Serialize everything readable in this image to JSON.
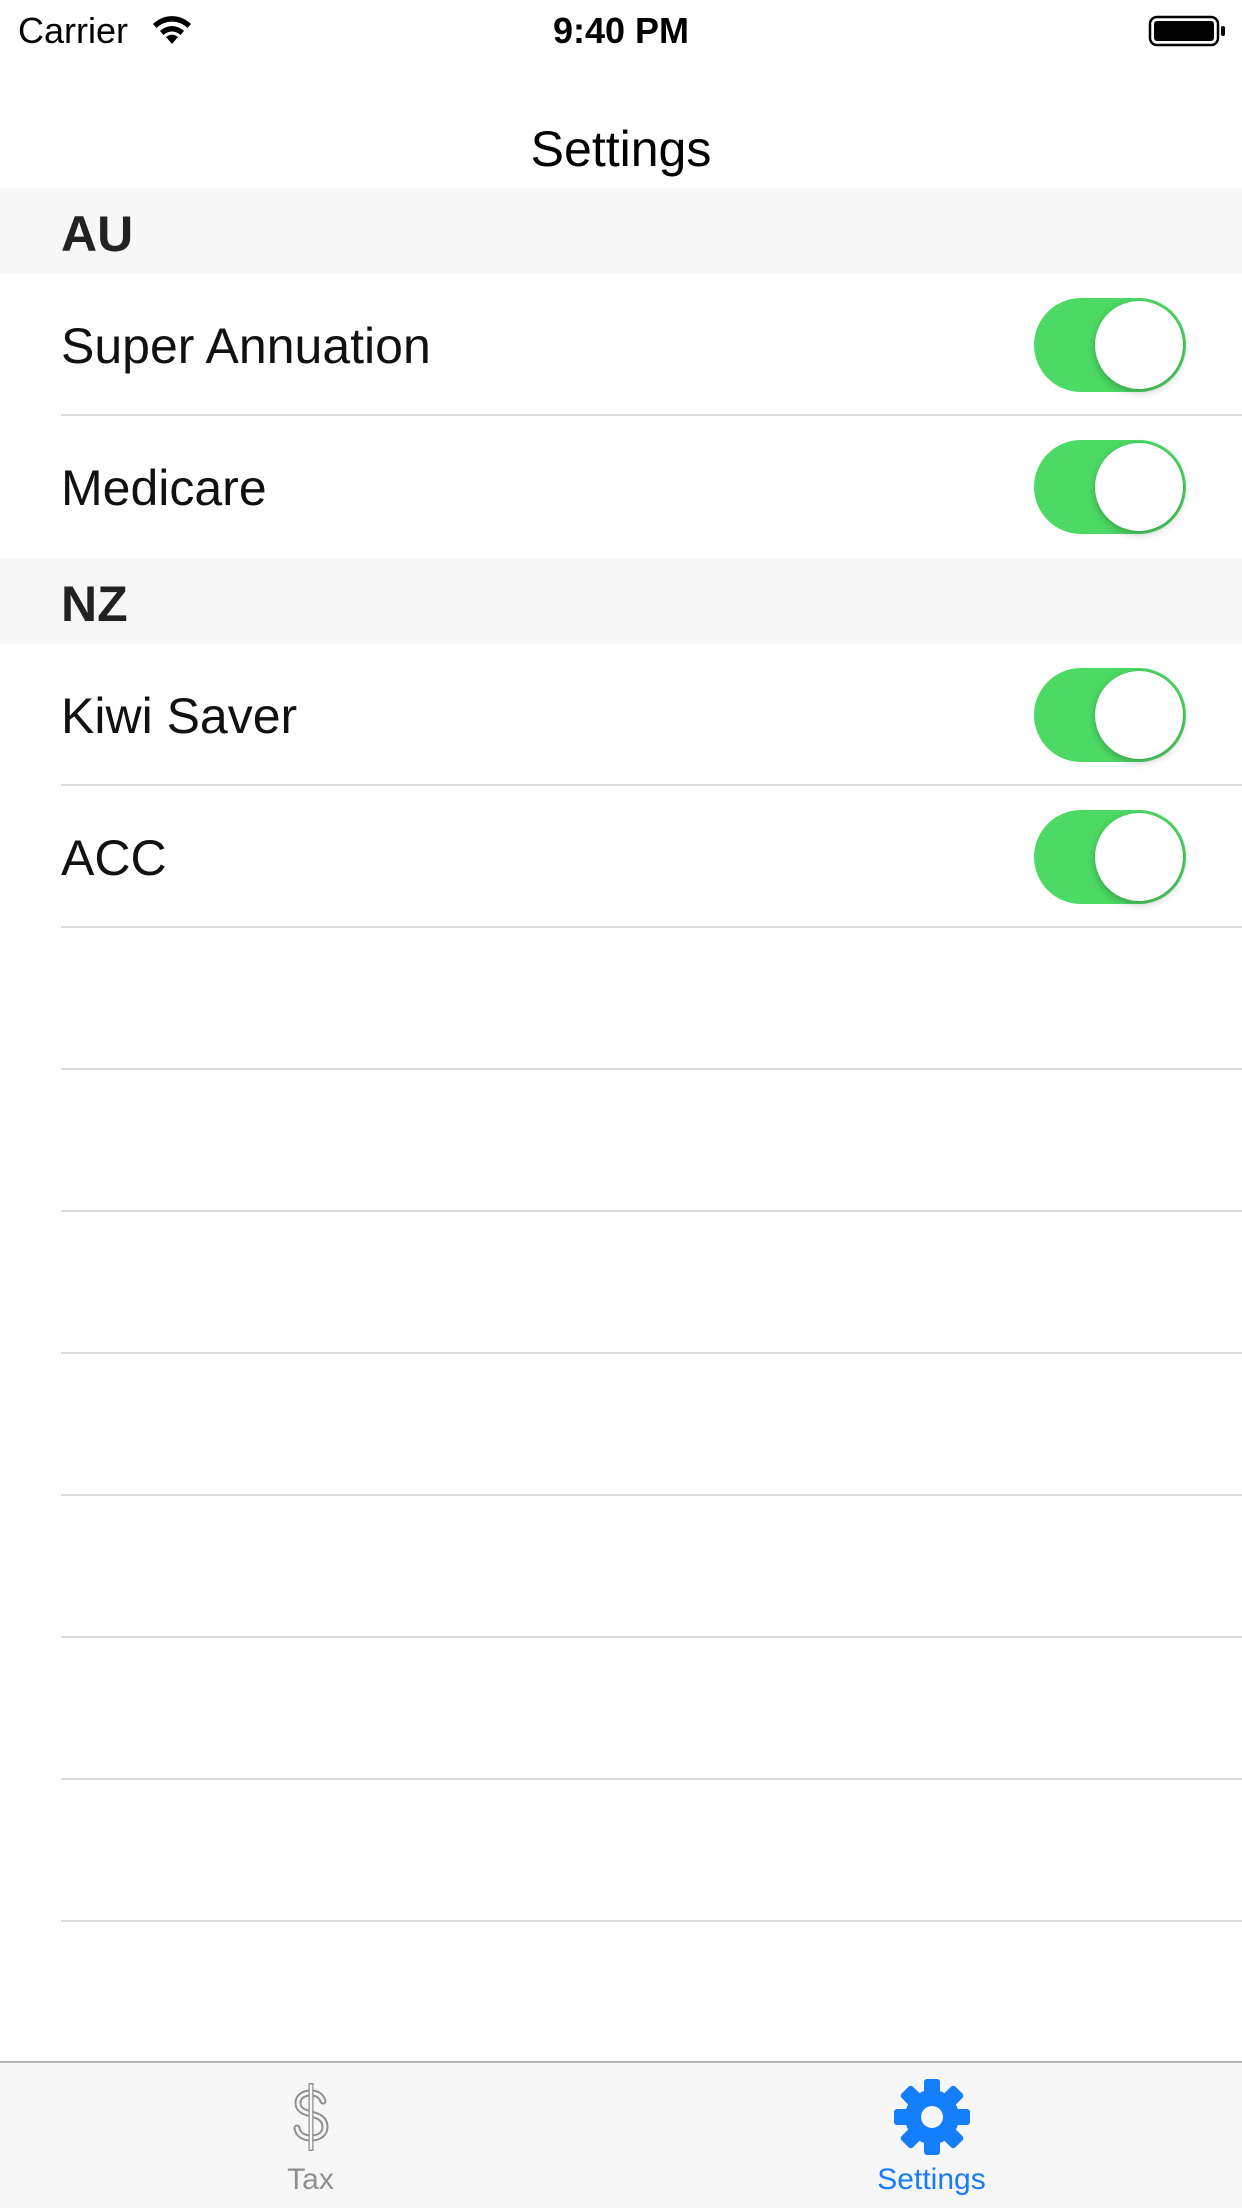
{
  "status_bar": {
    "carrier": "Carrier",
    "time": "9:40 PM",
    "wifi_icon": "wifi-icon",
    "battery_icon": "battery-icon"
  },
  "nav": {
    "title": "Settings"
  },
  "sections": [
    {
      "header": "AU",
      "rows": [
        {
          "label": "Super Annuation",
          "enabled": true
        },
        {
          "label": "Medicare",
          "enabled": true
        }
      ]
    },
    {
      "header": "NZ",
      "rows": [
        {
          "label": "Kiwi Saver",
          "enabled": true
        },
        {
          "label": "ACC",
          "enabled": true
        }
      ]
    }
  ],
  "tab_bar": {
    "tabs": [
      {
        "label": "Tax",
        "icon": "dollar-icon",
        "selected": false
      },
      {
        "label": "Settings",
        "icon": "gear-icon",
        "selected": true
      }
    ]
  },
  "colors": {
    "toggle_on": "#4cd964",
    "tab_selected": "#147efb",
    "tab_unselected": "#8e8e93",
    "section_header_bg": "#f7f7f7"
  }
}
